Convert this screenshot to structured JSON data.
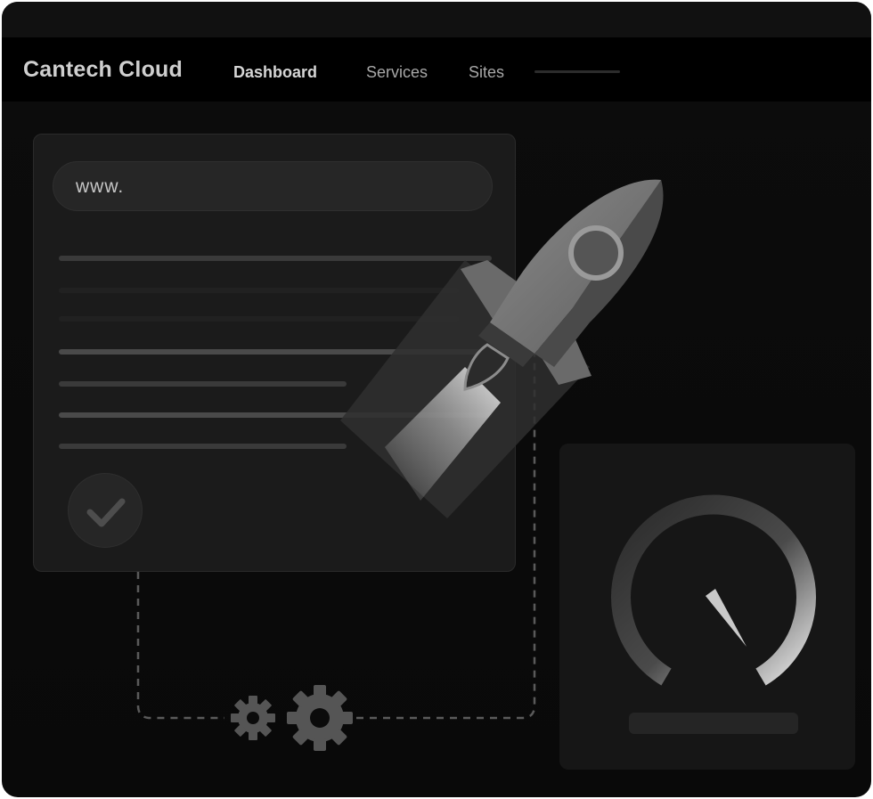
{
  "brand": {
    "name": "Cantech Cloud"
  },
  "nav": {
    "items": [
      {
        "label": "Dashboard",
        "active": true
      },
      {
        "label": "Services",
        "active": false
      },
      {
        "label": "Sites",
        "active": false
      }
    ]
  },
  "form_card": {
    "url_prefix": "www."
  },
  "icons": {
    "status": "check-icon",
    "rocket": "rocket-icon",
    "gears": "gear-icon",
    "meter": "speedometer-icon"
  },
  "colors": {
    "background": "#0b0b0b",
    "navbar": "#000000",
    "card": "#1b1b1b",
    "accent_light": "#d9d9d9"
  }
}
